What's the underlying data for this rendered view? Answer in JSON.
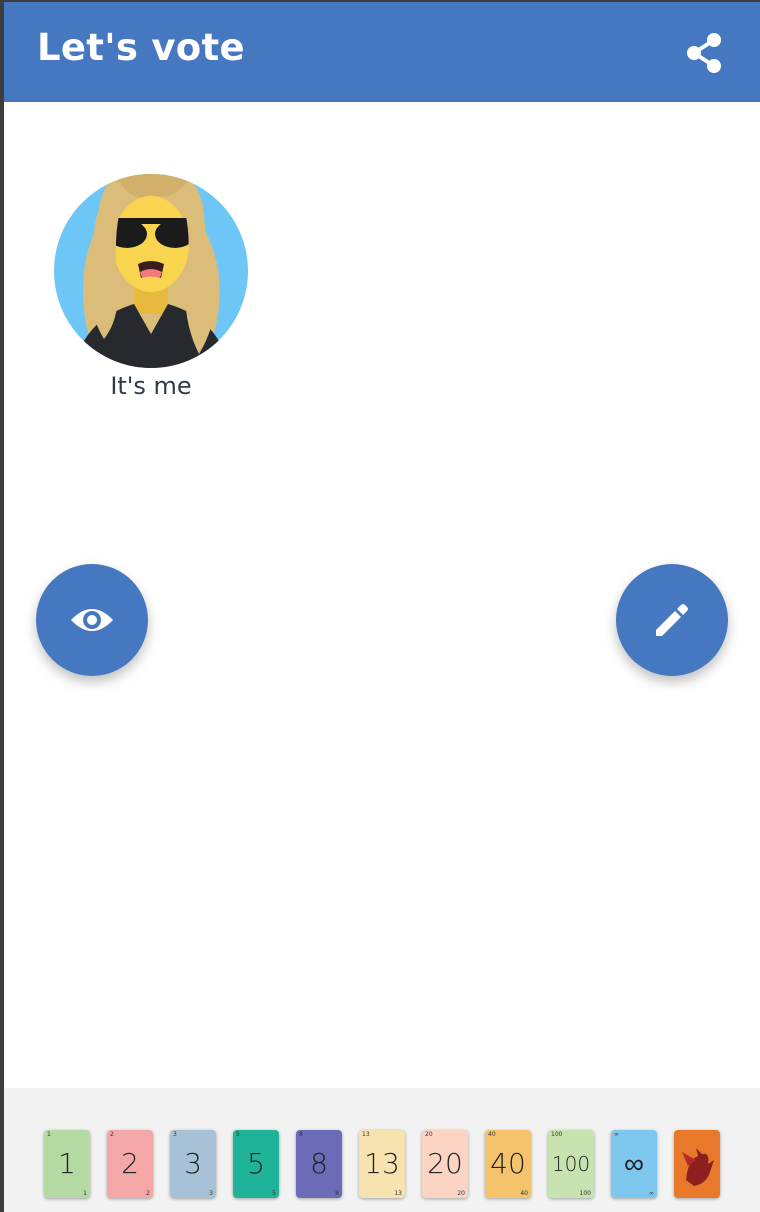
{
  "header": {
    "title": "Let's vote",
    "share_icon": "share-icon",
    "background": "#4677c1"
  },
  "participants": [
    {
      "name": "It's me",
      "avatar": "avatar-blonde-sunglasses"
    }
  ],
  "actions": {
    "reveal_icon": "eye-icon",
    "edit_icon": "pencil-icon",
    "fab_color": "#4677c1"
  },
  "cards": [
    {
      "label": "1",
      "color": "#b4d9a2"
    },
    {
      "label": "2",
      "color": "#f4a7a7"
    },
    {
      "label": "3",
      "color": "#a7c2d6"
    },
    {
      "label": "5",
      "color": "#1fb39a"
    },
    {
      "label": "8",
      "color": "#6b6bb8"
    },
    {
      "label": "13",
      "color": "#f7e3b0"
    },
    {
      "label": "20",
      "color": "#fbd4c4"
    },
    {
      "label": "40",
      "color": "#f5c36b"
    },
    {
      "label": "100",
      "color": "#c7e3b0"
    },
    {
      "label": "∞",
      "color": "#7ec8ef"
    },
    {
      "label": "",
      "color": "#e8792a"
    }
  ]
}
